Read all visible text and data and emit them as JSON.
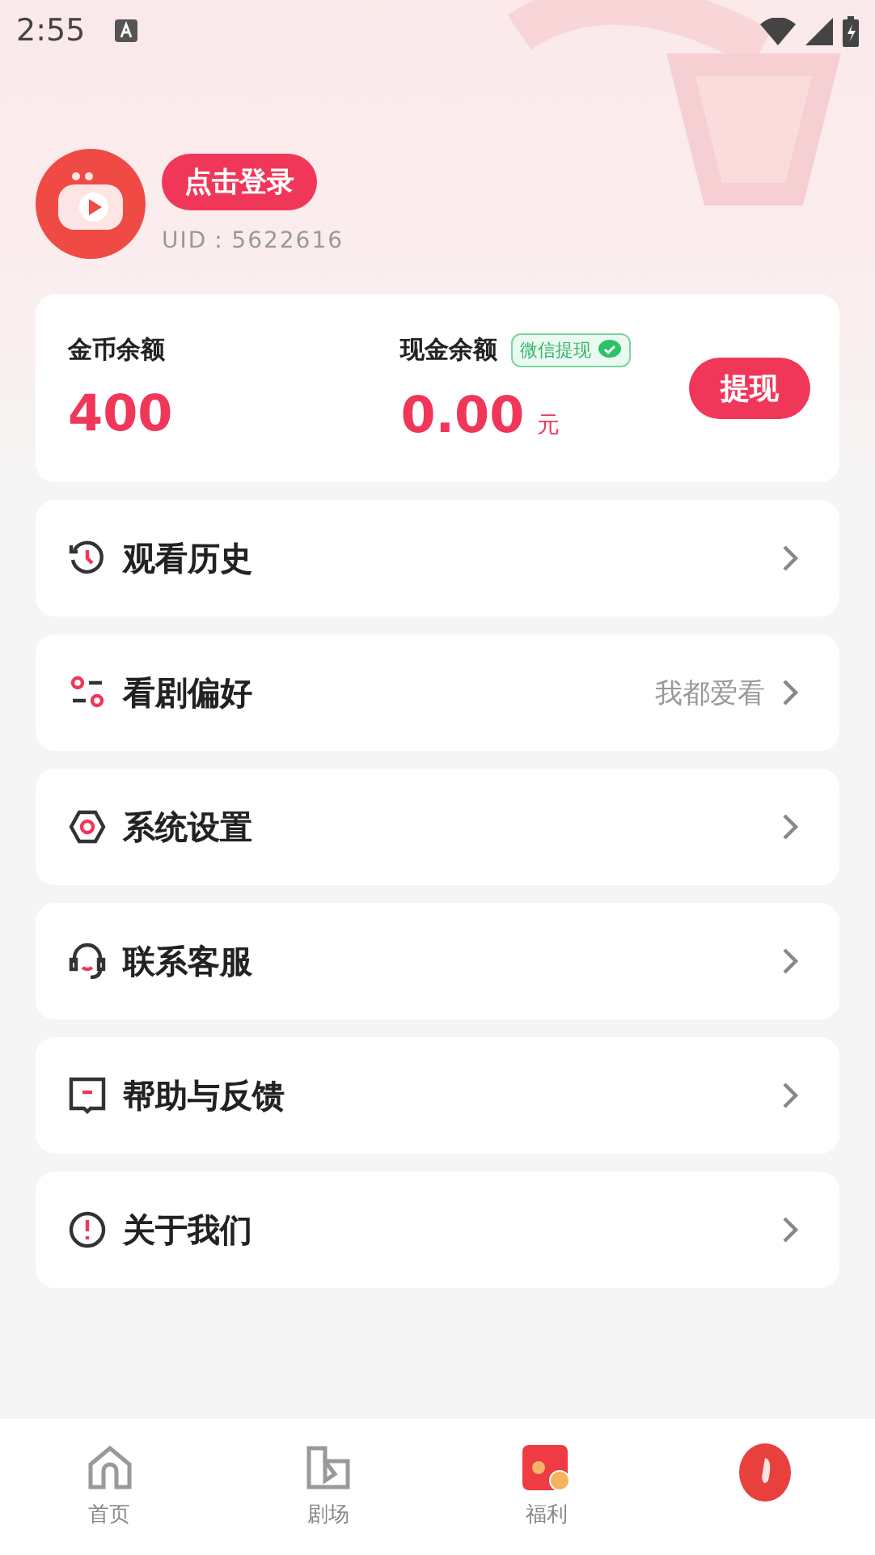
{
  "status_bar": {
    "time": "2:55"
  },
  "profile": {
    "login_button": "点击登录",
    "uid": "UID：5622616"
  },
  "wallet": {
    "coins": {
      "label": "金币余额",
      "value": "400"
    },
    "cash": {
      "label": "现金余额",
      "badge": "微信提现",
      "value": "0.00",
      "unit": "元"
    },
    "withdraw_button": "提现"
  },
  "menu": [
    {
      "label": "观看历史"
    },
    {
      "label": "看剧偏好",
      "value": "我都爱看"
    },
    {
      "label": "系统设置"
    },
    {
      "label": "联系客服"
    },
    {
      "label": "帮助与反馈"
    },
    {
      "label": "关于我们"
    }
  ],
  "bottom_nav": [
    {
      "label": "首页",
      "selected": false
    },
    {
      "label": "剧场",
      "selected": false
    },
    {
      "label": "福利",
      "selected": false
    },
    {
      "selected": true
    }
  ]
}
